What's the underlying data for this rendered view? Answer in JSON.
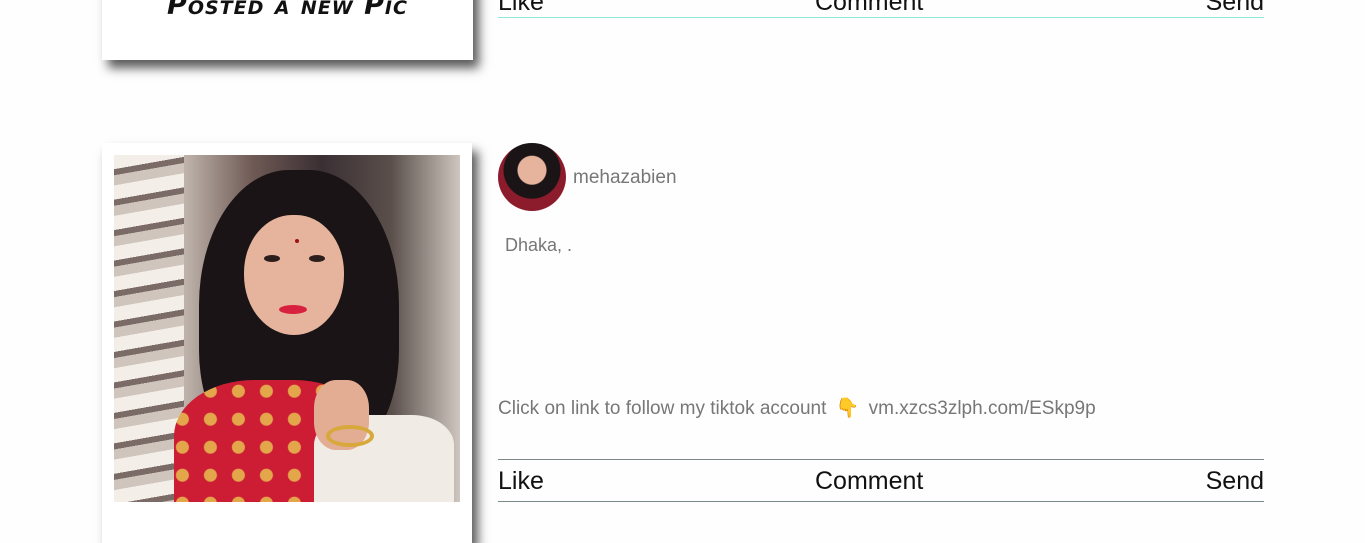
{
  "previous_post": {
    "caption": "Posted a new Pic",
    "actions": {
      "like": "Like",
      "comment": "Comment",
      "send": "Send"
    }
  },
  "post": {
    "username": "mehazabien",
    "location": "Dhaka, .",
    "description_text": "Click on link to follow my tiktok account",
    "pointing_icon": "👇",
    "link_text": "vm.xzcs3zlph.com/ESkp9p",
    "actions": {
      "like": "Like",
      "comment": "Comment",
      "send": "Send"
    }
  }
}
